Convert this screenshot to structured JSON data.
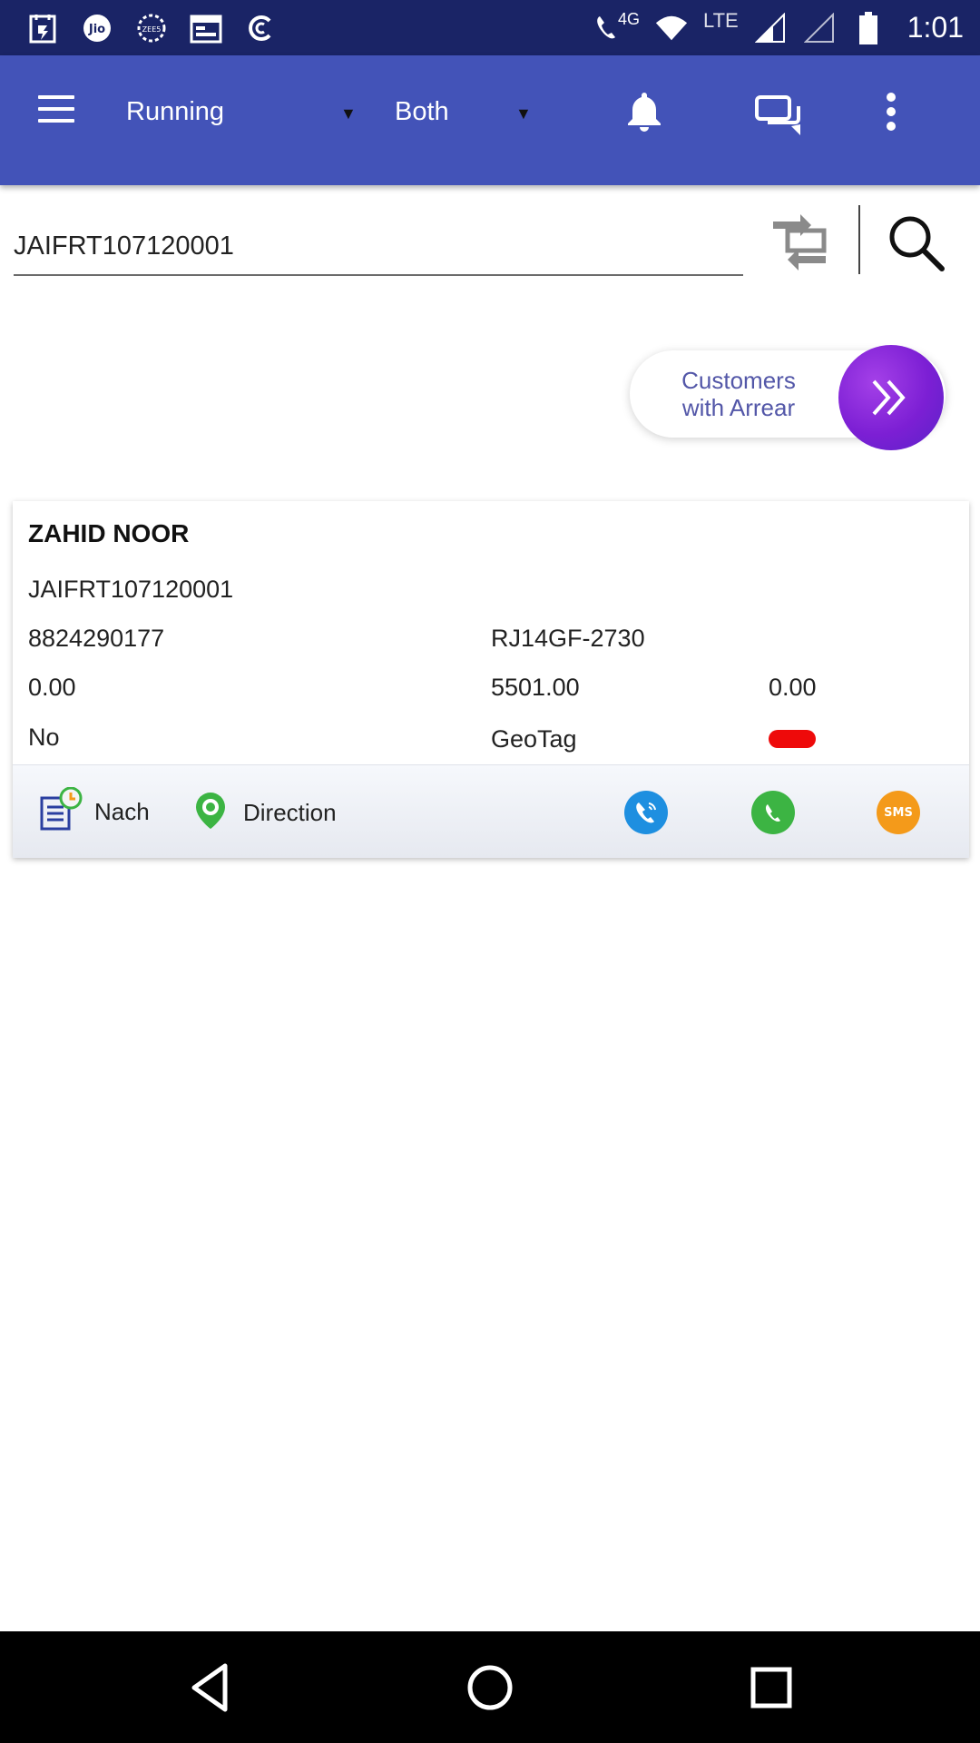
{
  "status_bar": {
    "network_label": "4G",
    "lte_label": "LTE",
    "time": "1:01",
    "left_icons": [
      "swiggy-icon",
      "jio-icon",
      "zee5-icon",
      "calendar-icon",
      "c-app-icon"
    ]
  },
  "app_bar": {
    "status_filter": "Running",
    "type_filter": "Both",
    "bg_color": "#4353b8"
  },
  "search": {
    "value": "JAIFRT107120001"
  },
  "arrear_button": {
    "line1": "Customers",
    "line2": "with Arrear"
  },
  "customer_card": {
    "name": "ZAHID NOOR",
    "account_id": "JAIFRT107120001",
    "phone": "8824290177",
    "vehicle_number": "RJ14GF-2730",
    "amount_1": "0.00",
    "amount_2": "5501.00",
    "amount_3": "0.00",
    "flag_value": "No",
    "geotag_label": "GeoTag",
    "geotag_status_color": "#ee0a0a"
  },
  "card_actions": {
    "nach_label": "Nach",
    "direction_label": "Direction",
    "sms_badge": "SMS"
  }
}
